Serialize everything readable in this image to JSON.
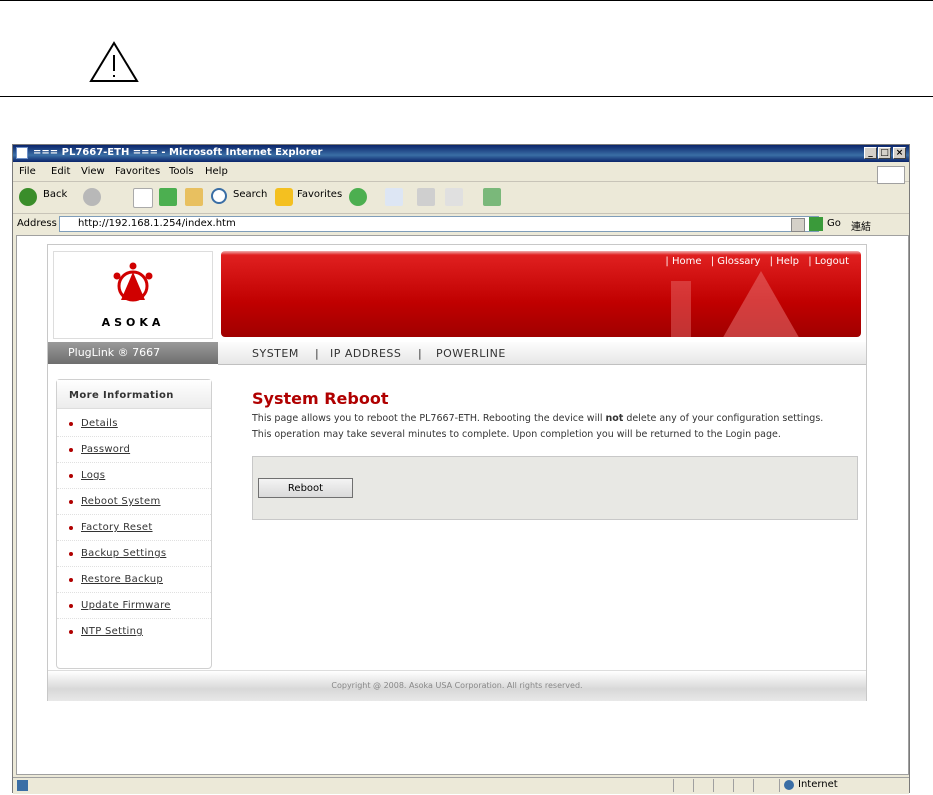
{
  "window": {
    "title": "=== PL7667-ETH === - Microsoft Internet Explorer",
    "controls": [
      "_",
      "□",
      "×"
    ]
  },
  "menu": [
    "File",
    "Edit",
    "View",
    "Favorites",
    "Tools",
    "Help"
  ],
  "toolbar": {
    "back_label": "Back",
    "search_label": "Search",
    "favorites_label": "Favorites"
  },
  "addressbar": {
    "label": "Address",
    "url": "http://192.168.1.254/index.htm",
    "go_label": "Go",
    "links_label": "連結"
  },
  "page": {
    "brand_logo_text": "ASOKA",
    "top_links": [
      "| Home",
      "| Glossary",
      "| Help",
      "| Logout"
    ],
    "product_label": "PlugLink ® 7667",
    "nav": [
      "SYSTEM",
      "IP ADDRESS",
      "POWERLINE"
    ],
    "sidebar": {
      "heading": "More Information",
      "items": [
        "Details",
        "Password",
        "Logs",
        "Reboot System",
        "Factory Reset",
        "Backup Settings",
        "Restore Backup",
        "Update Firmware",
        "NTP Setting"
      ]
    },
    "content": {
      "title": "System Reboot",
      "text_before_bold": "This page allows you to reboot the PL7667-ETH. Rebooting the device will ",
      "bold_word": "not",
      "text_after_bold": " delete any of your configuration settings.",
      "text_line2": "This operation may take several minutes to complete. Upon completion you will be returned to the Login page.",
      "reboot_button": "Reboot"
    },
    "footer": "Copyright @ 2008. Asoka USA Corporation. All rights reserved."
  },
  "statusbar": {
    "zone": "Internet"
  }
}
